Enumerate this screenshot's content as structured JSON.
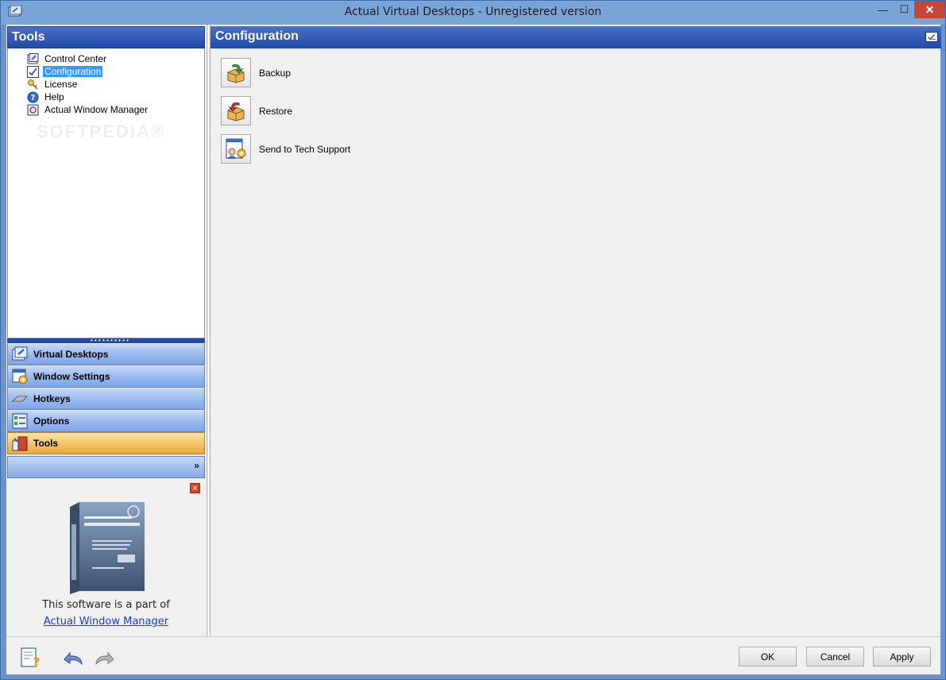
{
  "window": {
    "title": "Actual Virtual Desktops - Unregistered version",
    "minimize": "—",
    "maximize": "☐",
    "close": "✕"
  },
  "left": {
    "header": "Tools",
    "tree": [
      {
        "label": "Control Center",
        "icon": "control-center-icon"
      },
      {
        "label": "Configuration",
        "icon": "configuration-icon",
        "selected": true
      },
      {
        "label": "License",
        "icon": "key-icon"
      },
      {
        "label": "Help",
        "icon": "help-icon"
      },
      {
        "label": "Actual Window Manager",
        "icon": "window-manager-icon"
      }
    ],
    "nav": [
      {
        "label": "Virtual Desktops",
        "icon": "virtual-desktops-icon"
      },
      {
        "label": "Window Settings",
        "icon": "window-settings-icon"
      },
      {
        "label": "Hotkeys",
        "icon": "keyboard-icon"
      },
      {
        "label": "Options",
        "icon": "options-icon"
      },
      {
        "label": "Tools",
        "icon": "tools-icon",
        "active": true
      }
    ],
    "more_chevron": "»",
    "promo": {
      "close": "✕",
      "text": "This software is a part of",
      "link": "Actual Window Manager"
    }
  },
  "right": {
    "header": "Configuration",
    "actions": [
      {
        "label": "Backup",
        "icon": "backup-icon"
      },
      {
        "label": "Restore",
        "icon": "restore-icon"
      },
      {
        "label": "Send to Tech Support",
        "icon": "tech-support-icon"
      }
    ]
  },
  "bottom": {
    "ok": "OK",
    "cancel": "Cancel",
    "apply": "Apply"
  },
  "watermark": "SOFTPEDIA®"
}
